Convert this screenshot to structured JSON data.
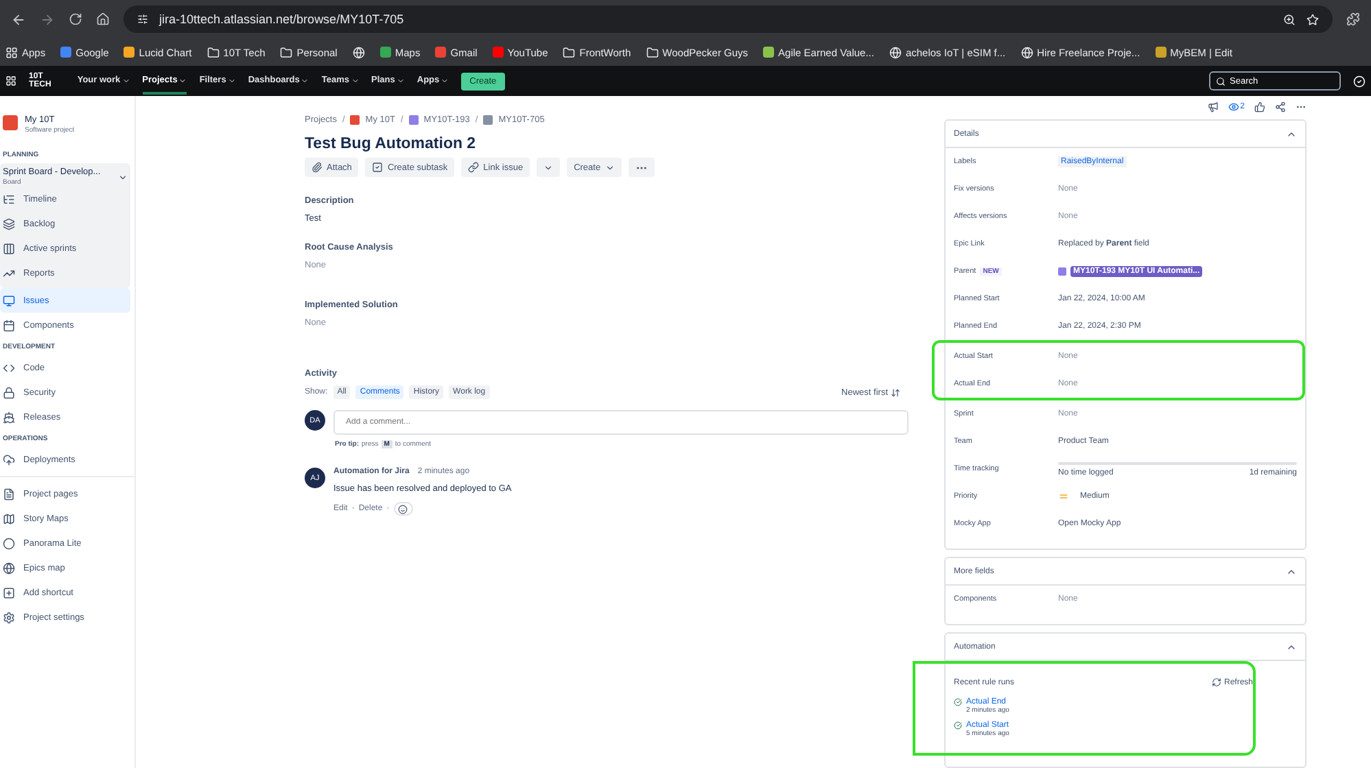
{
  "browser": {
    "url": "jira-10ttech.atlassian.net/browse/MY10T-705",
    "bookmarks": [
      {
        "kind": "apps",
        "label": "Apps"
      },
      {
        "kind": "site",
        "label": "Google",
        "color": "#4285f4"
      },
      {
        "kind": "site",
        "label": "Lucid Chart",
        "color": "#f5a623"
      },
      {
        "kind": "folder",
        "label": "10T Tech"
      },
      {
        "kind": "folder",
        "label": "Personal"
      },
      {
        "kind": "globe"
      },
      {
        "kind": "site",
        "label": "Maps",
        "color": "#34a853"
      },
      {
        "kind": "site",
        "label": "Gmail",
        "color": "#ea4335"
      },
      {
        "kind": "site",
        "label": "YouTube",
        "color": "#ff0000"
      },
      {
        "kind": "folder",
        "label": "FrontWorth"
      },
      {
        "kind": "folder",
        "label": "WoodPecker Guys"
      },
      {
        "kind": "site",
        "label": "Agile Earned Value...",
        "color": "#8bc34a"
      },
      {
        "kind": "globe",
        "label": "achelos IoT | eSIM f..."
      },
      {
        "kind": "globe",
        "label": "Hire Freelance Proje..."
      },
      {
        "kind": "site",
        "label": "MyBEM | Edit",
        "color": "#c9a227"
      }
    ]
  },
  "nav": {
    "logo_top": "10T",
    "logo_bottom": "TECH",
    "menus": [
      {
        "label": "Your work",
        "selected": false
      },
      {
        "label": "Projects",
        "selected": true
      },
      {
        "label": "Filters",
        "selected": false
      },
      {
        "label": "Dashboards",
        "selected": false
      },
      {
        "label": "Teams",
        "selected": false
      },
      {
        "label": "Plans",
        "selected": false
      },
      {
        "label": "Apps",
        "selected": false
      }
    ],
    "create": "Create",
    "search_placeholder": "Search"
  },
  "sidebar": {
    "project": "My 10T",
    "project_type": "Software project",
    "sections": [
      {
        "title": "PLANNING",
        "board": {
          "title": "Sprint Board - Develop...",
          "subtitle": "Board",
          "items": [
            {
              "label": "Timeline",
              "selected": false
            },
            {
              "label": "Backlog",
              "selected": false
            },
            {
              "label": "Active sprints",
              "selected": false
            },
            {
              "label": "Reports",
              "selected": false
            }
          ]
        },
        "items": [
          {
            "label": "Issues",
            "selected": true
          },
          {
            "label": "Components",
            "selected": false
          }
        ]
      },
      {
        "title": "DEVELOPMENT",
        "items": [
          {
            "label": "Code",
            "selected": false
          },
          {
            "label": "Security",
            "selected": false
          },
          {
            "label": "Releases",
            "selected": false
          }
        ]
      },
      {
        "title": "OPERATIONS",
        "items": [
          {
            "label": "Deployments",
            "selected": false
          }
        ]
      }
    ],
    "extra": [
      {
        "label": "Project pages",
        "selected": false
      },
      {
        "label": "Story Maps",
        "selected": false
      },
      {
        "label": "Panorama Lite",
        "selected": false
      },
      {
        "label": "Epics map",
        "selected": false
      },
      {
        "label": "Add shortcut",
        "selected": false
      },
      {
        "label": "Project settings",
        "selected": false
      }
    ]
  },
  "issue": {
    "breadcrumbs": [
      "Projects",
      "My 10T",
      "MY10T-193",
      "MY10T-705"
    ],
    "crumb_separator": "/",
    "title": "Test Bug Automation 2",
    "actions": [
      "Attach",
      "Create subtask",
      "Link issue",
      "Create"
    ],
    "fields": [
      {
        "label": "Description",
        "value": "Test",
        "empty": false
      },
      {
        "label": "Root Cause Analysis",
        "value": "None",
        "empty": true
      },
      {
        "label": "Implemented Solution",
        "value": "None",
        "empty": true
      }
    ],
    "activity": {
      "title": "Activity",
      "show": "Show:",
      "filters": [
        {
          "label": "All",
          "selected": false
        },
        {
          "label": "Comments",
          "selected": true
        },
        {
          "label": "History",
          "selected": false
        },
        {
          "label": "Work log",
          "selected": false
        }
      ],
      "sort": "Newest first",
      "avatar": "DA",
      "placeholder": "Add a comment...",
      "tip_bold": "Pro tip:",
      "tip_press": "press",
      "tip_key": "M",
      "tip_end": "to comment",
      "comments": [
        {
          "avatar": "AJ",
          "author": "Automation for Jira",
          "time": "2 minutes ago",
          "body": "Issue has been resolved and deployed to GA",
          "edit": "Edit",
          "delete": "Delete",
          "separator": "·"
        }
      ]
    }
  },
  "side": {
    "watchers": "2",
    "details": {
      "title": "Details",
      "expanded": true,
      "rows": [
        {
          "label": "Labels",
          "kind": "tag",
          "value": "RaisedByInternal",
          "highlighted": false
        },
        {
          "label": "Fix versions",
          "kind": "empty",
          "value": "None",
          "highlighted": false
        },
        {
          "label": "Affects versions",
          "kind": "empty",
          "value": "None",
          "highlighted": false
        },
        {
          "label": "Epic Link",
          "kind": "rich",
          "value": "Replaced by **Parent** field",
          "highlighted": false
        },
        {
          "label": "Parent",
          "kind": "parent",
          "badge": "NEW",
          "value": "MY10T-193 MY10T UI Automati...",
          "highlighted": false
        },
        {
          "label": "Planned Start",
          "kind": "text",
          "value": "Jan 22, 2024, 10:00 AM",
          "highlighted": false
        },
        {
          "label": "Planned End",
          "kind": "text",
          "value": "Jan 22, 2024, 2:30 PM",
          "highlighted": false
        },
        {
          "label": "Actual Start",
          "kind": "empty",
          "value": "None",
          "highlighted": true
        },
        {
          "label": "Actual End",
          "kind": "empty",
          "value": "None",
          "highlighted": true
        },
        {
          "label": "Sprint",
          "kind": "empty",
          "value": "None",
          "highlighted": false
        },
        {
          "label": "Team",
          "kind": "text",
          "value": "Product Team",
          "highlighted": false
        },
        {
          "label": "Time tracking",
          "kind": "time",
          "value": "No time logged",
          "remaining": "1d remaining",
          "level": 0,
          "highlighted": false
        },
        {
          "label": "Priority",
          "kind": "priority",
          "value": "Medium",
          "highlighted": false
        },
        {
          "label": "Mocky App",
          "kind": "text",
          "value": "Open Mocky App",
          "highlighted": false
        }
      ]
    },
    "more": {
      "title": "More fields",
      "expanded": true,
      "rows": [
        {
          "label": "Components",
          "value": "None"
        }
      ]
    },
    "automation": {
      "title": "Automation",
      "expanded": true,
      "subtitle": "Recent rule runs",
      "refresh": "Refresh",
      "highlighted": true,
      "runs": [
        {
          "name": "Actual End",
          "time": "2 minutes ago"
        },
        {
          "name": "Actual Start",
          "time": "5 minutes ago"
        }
      ]
    }
  }
}
